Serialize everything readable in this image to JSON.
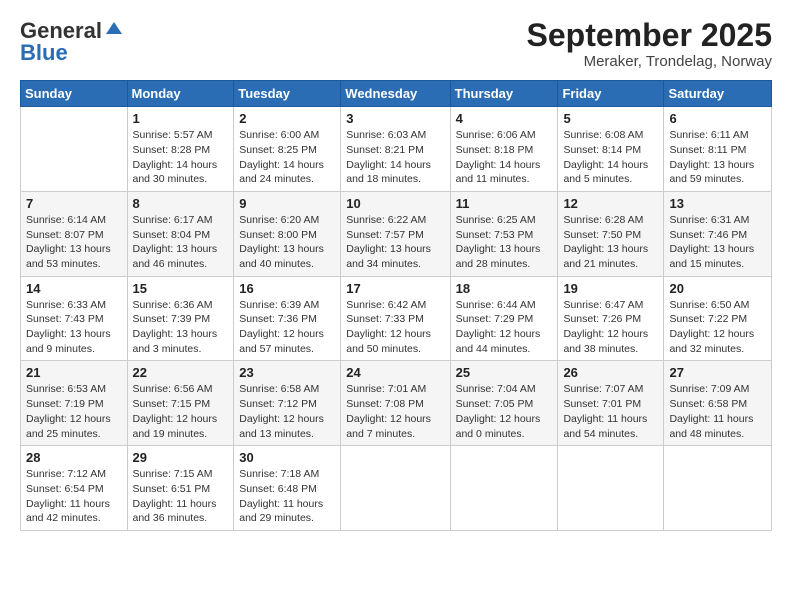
{
  "header": {
    "logo_line1": "General",
    "logo_line2": "Blue",
    "month_title": "September 2025",
    "location": "Meraker, Trondelag, Norway"
  },
  "days_of_week": [
    "Sunday",
    "Monday",
    "Tuesday",
    "Wednesday",
    "Thursday",
    "Friday",
    "Saturday"
  ],
  "weeks": [
    [
      {
        "day": "",
        "info": ""
      },
      {
        "day": "1",
        "info": "Sunrise: 5:57 AM\nSunset: 8:28 PM\nDaylight: 14 hours\nand 30 minutes."
      },
      {
        "day": "2",
        "info": "Sunrise: 6:00 AM\nSunset: 8:25 PM\nDaylight: 14 hours\nand 24 minutes."
      },
      {
        "day": "3",
        "info": "Sunrise: 6:03 AM\nSunset: 8:21 PM\nDaylight: 14 hours\nand 18 minutes."
      },
      {
        "day": "4",
        "info": "Sunrise: 6:06 AM\nSunset: 8:18 PM\nDaylight: 14 hours\nand 11 minutes."
      },
      {
        "day": "5",
        "info": "Sunrise: 6:08 AM\nSunset: 8:14 PM\nDaylight: 14 hours\nand 5 minutes."
      },
      {
        "day": "6",
        "info": "Sunrise: 6:11 AM\nSunset: 8:11 PM\nDaylight: 13 hours\nand 59 minutes."
      }
    ],
    [
      {
        "day": "7",
        "info": "Sunrise: 6:14 AM\nSunset: 8:07 PM\nDaylight: 13 hours\nand 53 minutes."
      },
      {
        "day": "8",
        "info": "Sunrise: 6:17 AM\nSunset: 8:04 PM\nDaylight: 13 hours\nand 46 minutes."
      },
      {
        "day": "9",
        "info": "Sunrise: 6:20 AM\nSunset: 8:00 PM\nDaylight: 13 hours\nand 40 minutes."
      },
      {
        "day": "10",
        "info": "Sunrise: 6:22 AM\nSunset: 7:57 PM\nDaylight: 13 hours\nand 34 minutes."
      },
      {
        "day": "11",
        "info": "Sunrise: 6:25 AM\nSunset: 7:53 PM\nDaylight: 13 hours\nand 28 minutes."
      },
      {
        "day": "12",
        "info": "Sunrise: 6:28 AM\nSunset: 7:50 PM\nDaylight: 13 hours\nand 21 minutes."
      },
      {
        "day": "13",
        "info": "Sunrise: 6:31 AM\nSunset: 7:46 PM\nDaylight: 13 hours\nand 15 minutes."
      }
    ],
    [
      {
        "day": "14",
        "info": "Sunrise: 6:33 AM\nSunset: 7:43 PM\nDaylight: 13 hours\nand 9 minutes."
      },
      {
        "day": "15",
        "info": "Sunrise: 6:36 AM\nSunset: 7:39 PM\nDaylight: 13 hours\nand 3 minutes."
      },
      {
        "day": "16",
        "info": "Sunrise: 6:39 AM\nSunset: 7:36 PM\nDaylight: 12 hours\nand 57 minutes."
      },
      {
        "day": "17",
        "info": "Sunrise: 6:42 AM\nSunset: 7:33 PM\nDaylight: 12 hours\nand 50 minutes."
      },
      {
        "day": "18",
        "info": "Sunrise: 6:44 AM\nSunset: 7:29 PM\nDaylight: 12 hours\nand 44 minutes."
      },
      {
        "day": "19",
        "info": "Sunrise: 6:47 AM\nSunset: 7:26 PM\nDaylight: 12 hours\nand 38 minutes."
      },
      {
        "day": "20",
        "info": "Sunrise: 6:50 AM\nSunset: 7:22 PM\nDaylight: 12 hours\nand 32 minutes."
      }
    ],
    [
      {
        "day": "21",
        "info": "Sunrise: 6:53 AM\nSunset: 7:19 PM\nDaylight: 12 hours\nand 25 minutes."
      },
      {
        "day": "22",
        "info": "Sunrise: 6:56 AM\nSunset: 7:15 PM\nDaylight: 12 hours\nand 19 minutes."
      },
      {
        "day": "23",
        "info": "Sunrise: 6:58 AM\nSunset: 7:12 PM\nDaylight: 12 hours\nand 13 minutes."
      },
      {
        "day": "24",
        "info": "Sunrise: 7:01 AM\nSunset: 7:08 PM\nDaylight: 12 hours\nand 7 minutes."
      },
      {
        "day": "25",
        "info": "Sunrise: 7:04 AM\nSunset: 7:05 PM\nDaylight: 12 hours\nand 0 minutes."
      },
      {
        "day": "26",
        "info": "Sunrise: 7:07 AM\nSunset: 7:01 PM\nDaylight: 11 hours\nand 54 minutes."
      },
      {
        "day": "27",
        "info": "Sunrise: 7:09 AM\nSunset: 6:58 PM\nDaylight: 11 hours\nand 48 minutes."
      }
    ],
    [
      {
        "day": "28",
        "info": "Sunrise: 7:12 AM\nSunset: 6:54 PM\nDaylight: 11 hours\nand 42 minutes."
      },
      {
        "day": "29",
        "info": "Sunrise: 7:15 AM\nSunset: 6:51 PM\nDaylight: 11 hours\nand 36 minutes."
      },
      {
        "day": "30",
        "info": "Sunrise: 7:18 AM\nSunset: 6:48 PM\nDaylight: 11 hours\nand 29 minutes."
      },
      {
        "day": "",
        "info": ""
      },
      {
        "day": "",
        "info": ""
      },
      {
        "day": "",
        "info": ""
      },
      {
        "day": "",
        "info": ""
      }
    ]
  ]
}
